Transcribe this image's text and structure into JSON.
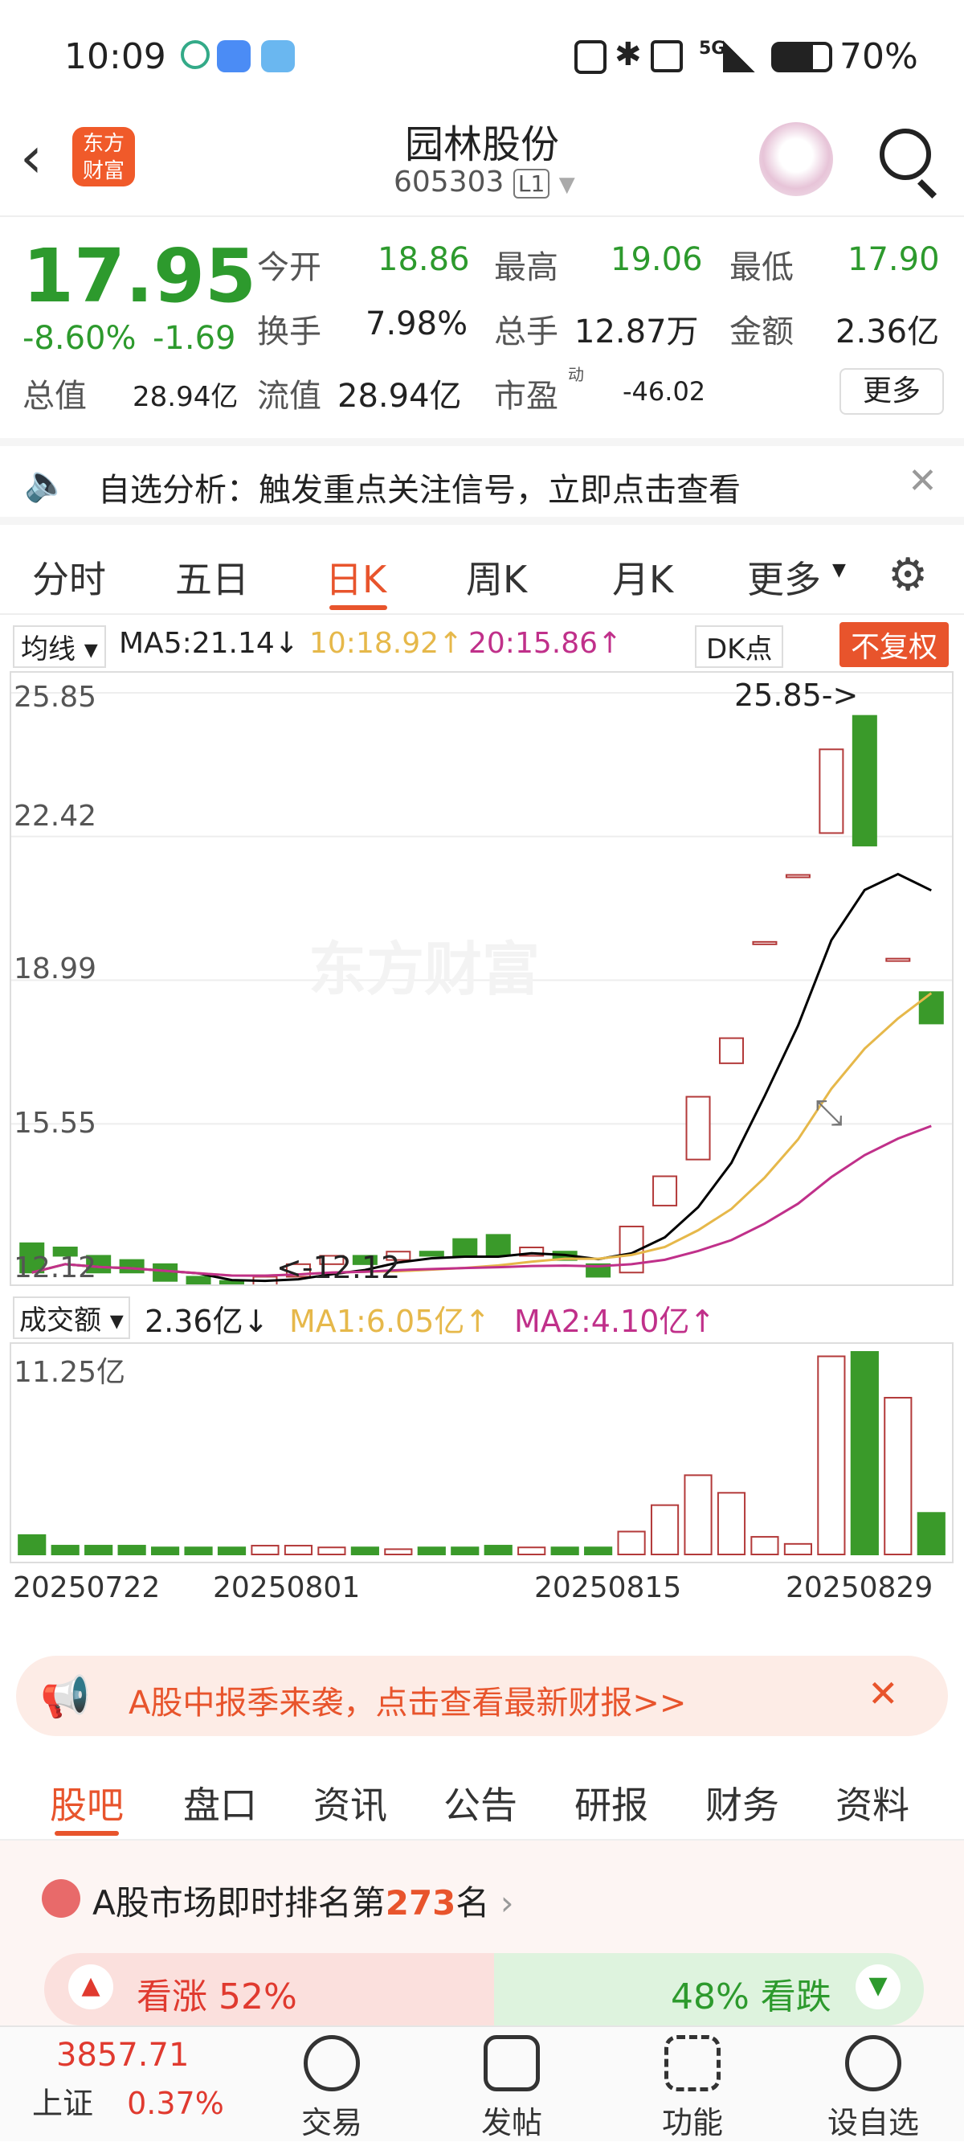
{
  "status": {
    "time": "10:09",
    "network": "5G",
    "battery": "70%"
  },
  "header": {
    "name": "园林股份",
    "code": "605303",
    "level": "L1",
    "logo": "东方\n财富"
  },
  "quote": {
    "price": "17.95",
    "pct": "-8.60%",
    "chg": "-1.69",
    "open_label": "今开",
    "open": "18.86",
    "high_label": "最高",
    "high": "19.06",
    "low_label": "最低",
    "low": "17.90",
    "turnover_label": "换手",
    "turnover": "7.98%",
    "volume_label": "总手",
    "volume": "12.87万",
    "amount_label": "金额",
    "amount": "2.36亿",
    "mktcap_label": "总值",
    "mktcap": "28.94亿",
    "float_label": "流值",
    "float": "28.94亿",
    "pe_label": "市盈",
    "pe_sup": "动",
    "pe": "-46.02",
    "more": "更多"
  },
  "banner1": {
    "text": "自选分析：触发重点关注信号，立即点击查看"
  },
  "tabs": [
    "分时",
    "五日",
    "日K",
    "周K",
    "月K",
    "更多"
  ],
  "active_tab": "日K",
  "ma": {
    "selector": "均线",
    "ma5": "MA5:21.14↓",
    "ma10": "10:18.92↑",
    "ma20": "20:15.86↑",
    "dk": "DK点",
    "fq": "不复权"
  },
  "kchart": {
    "y_labels": [
      "25.85",
      "22.42",
      "18.99",
      "15.55",
      "12.12"
    ],
    "high_note": "25.85->",
    "low_note": "<-12.12",
    "watermark": "东方财富"
  },
  "vol": {
    "selector": "成交额",
    "value": "2.36亿↓",
    "ma1": "MA1:6.05亿↑",
    "ma2": "MA2:4.10亿↑",
    "max": "11.25亿"
  },
  "dates": [
    "20250722",
    "20250801",
    "20250815",
    "20250829"
  ],
  "banner2": {
    "text": "A股中报季来袭，点击查看最新财报>>"
  },
  "tabs2": [
    "股吧",
    "盘口",
    "资讯",
    "公告",
    "研报",
    "财务",
    "资料"
  ],
  "rank": {
    "prefix": "A股市场即时排名第",
    "num": "273",
    "suffix": "名"
  },
  "vote": {
    "up": "看涨 52%",
    "down": "48% 看跌"
  },
  "nav": {
    "index_value": "3857.71",
    "index_name": "上证",
    "index_pct": "0.37%",
    "items": [
      "交易",
      "发帖",
      "功能",
      "设自选"
    ]
  },
  "chart_data": {
    "type": "candlestick",
    "ylim": [
      12.12,
      25.85
    ],
    "candles": [
      {
        "o": 12.7,
        "c": 12.0
      },
      {
        "o": 12.6,
        "c": 12.4
      },
      {
        "o": 12.4,
        "c": 12.0
      },
      {
        "o": 12.3,
        "c": 12.0
      },
      {
        "o": 12.2,
        "c": 11.8
      },
      {
        "o": 11.9,
        "c": 11.7
      },
      {
        "o": 11.8,
        "c": 11.6
      },
      {
        "o": 11.6,
        "c": 11.9
      },
      {
        "o": 11.9,
        "c": 12.2
      },
      {
        "o": 12.2,
        "c": 12.4
      },
      {
        "o": 12.4,
        "c": 12.2
      },
      {
        "o": 12.3,
        "c": 12.5
      },
      {
        "o": 12.5,
        "c": 12.4
      },
      {
        "o": 12.8,
        "c": 12.4
      },
      {
        "o": 12.9,
        "c": 12.4
      },
      {
        "o": 12.4,
        "c": 12.6
      },
      {
        "o": 12.5,
        "c": 12.3
      },
      {
        "o": 12.2,
        "c": 11.9
      },
      {
        "o": 12.0,
        "c": 13.1
      },
      {
        "o": 13.6,
        "c": 14.3
      },
      {
        "o": 14.7,
        "c": 16.2
      },
      {
        "o": 17.0,
        "c": 17.6
      },
      {
        "o": 19.9,
        "c": 19.9
      },
      {
        "o": 21.5,
        "c": 21.5
      },
      {
        "o": 22.5,
        "c": 24.5
      },
      {
        "o": 25.3,
        "c": 22.2
      },
      {
        "o": 19.5,
        "c": 19.5
      },
      {
        "o": 18.7,
        "c": 17.95
      }
    ],
    "volumes": [
      1.1,
      0.5,
      0.5,
      0.5,
      0.4,
      0.4,
      0.4,
      0.5,
      0.5,
      0.4,
      0.4,
      0.3,
      0.4,
      0.4,
      0.5,
      0.4,
      0.4,
      0.4,
      1.3,
      2.8,
      4.5,
      3.5,
      1.0,
      0.6,
      11.25,
      11.5,
      8.9,
      2.36
    ]
  }
}
